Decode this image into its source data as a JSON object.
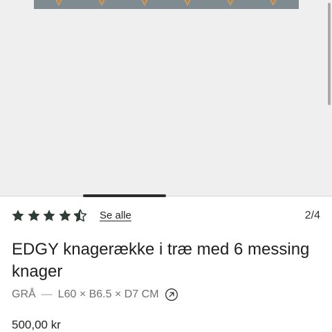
{
  "product": {
    "title": "EDGY knagerække i træ med 6 messing knager",
    "color": "GRÅ",
    "separator": "—",
    "dimensions": "L60 × B6.5 × D7 CM",
    "price": "500,00 kr"
  },
  "rating": {
    "value": 4.5,
    "max": 5,
    "see_all_label": "Se alle"
  },
  "gallery": {
    "page_indicator": "2/4",
    "progress": 0.25,
    "rack_color": "#7f8a91",
    "hook_color": "#c8a06a",
    "hook_count": 6
  },
  "icons": {
    "star": "star-icon",
    "half_star": "half-star-icon",
    "external_link": "arrow-up-right-circle-icon"
  }
}
